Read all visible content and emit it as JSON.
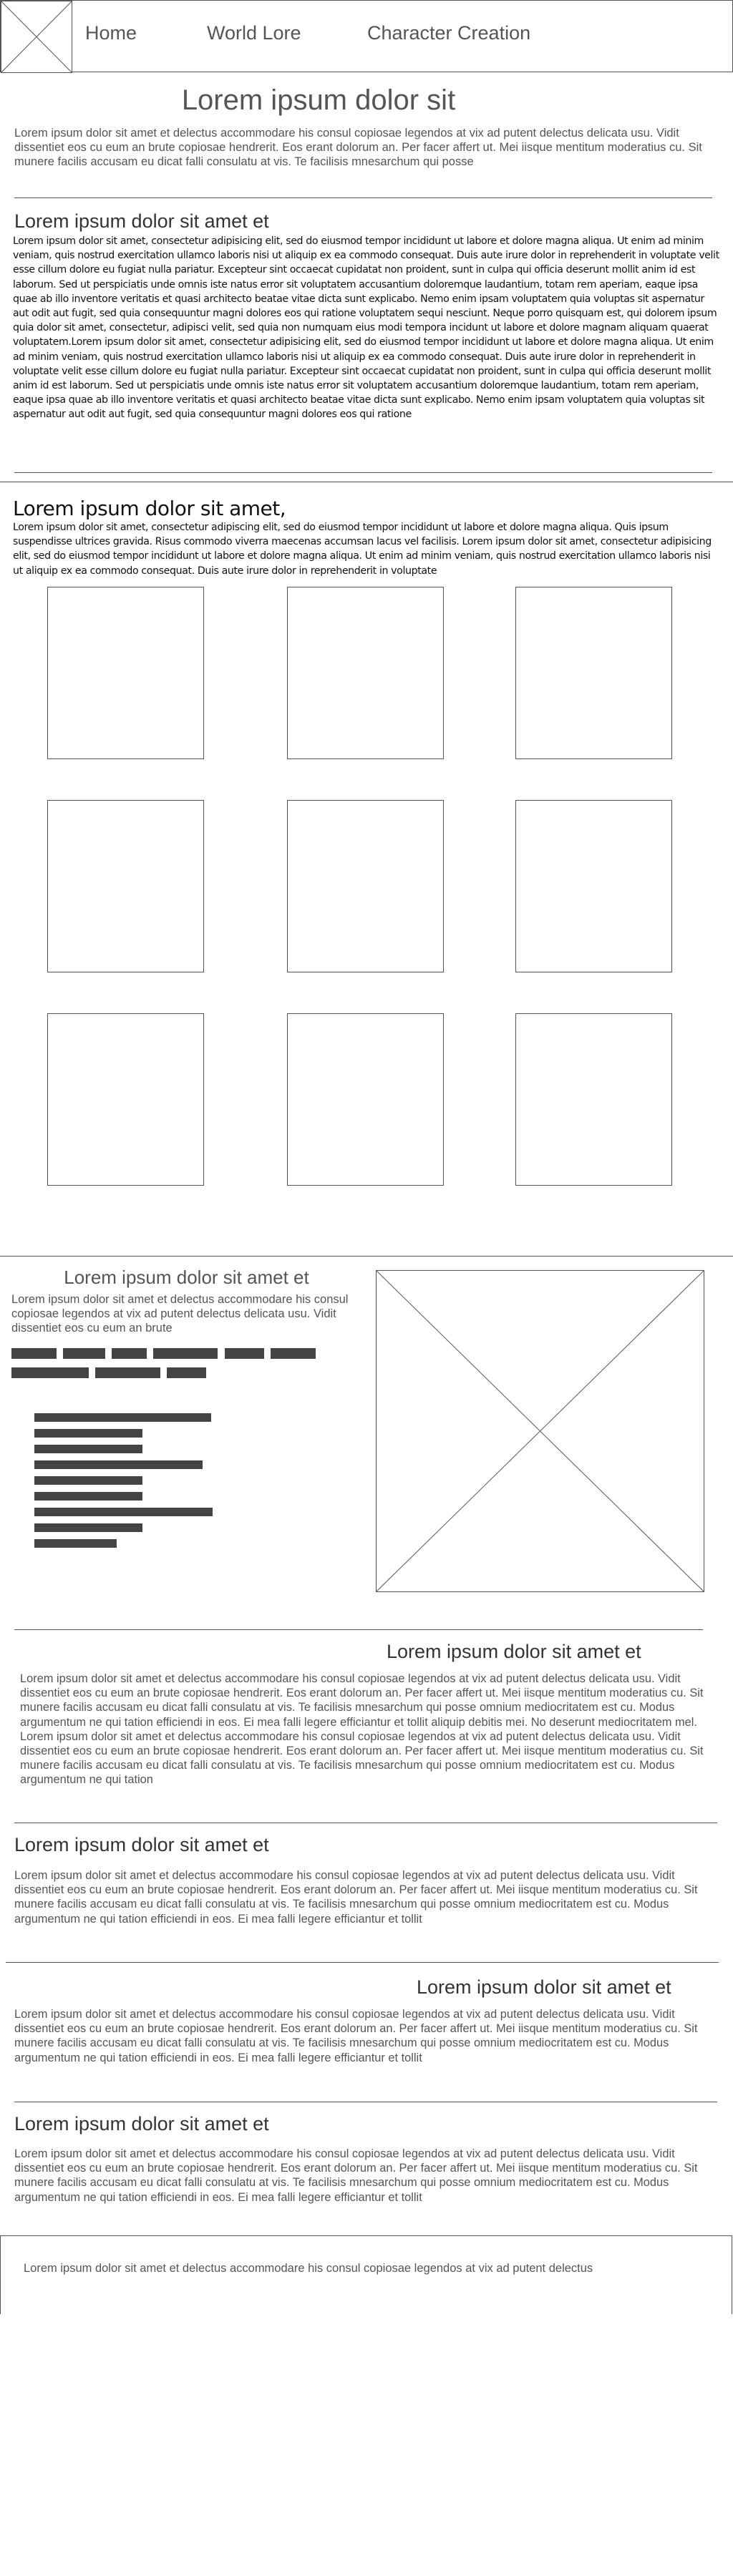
{
  "header": {
    "nav": [
      "Home",
      "World Lore",
      "Character Creation"
    ]
  },
  "hero": {
    "title": "Lorem ipsum dolor sit",
    "text": "Lorem ipsum dolor sit amet et delectus accommodare his consul copiosae legendos at vix ad putent delectus delicata usu. Vidit dissentiet eos cu eum an brute copiosae hendrerit. Eos erant dolorum an. Per facer affert ut. Mei iisque mentitum moderatius cu. Sit munere facilis accusam eu dicat falli consulatu at vis. Te facilisis mnesarchum qui posse"
  },
  "section1": {
    "title": "Lorem ipsum dolor sit amet et",
    "text": "Lorem ipsum dolor sit amet, consectetur adipisicing elit, sed do eiusmod tempor incididunt ut labore et dolore magna aliqua. Ut enim ad minim veniam, quis nostrud exercitation ullamco laboris nisi ut aliquip ex ea commodo consequat. Duis aute irure dolor in reprehenderit in voluptate velit esse cillum dolore eu fugiat nulla pariatur. Excepteur sint occaecat cupidatat non proident, sunt in culpa qui officia deserunt mollit anim id est laborum. Sed ut perspiciatis unde omnis iste natus error sit voluptatem accusantium doloremque laudantium, totam rem aperiam, eaque ipsa quae ab illo inventore veritatis et quasi architecto beatae vitae dicta sunt explicabo. Nemo enim ipsam voluptatem quia voluptas sit aspernatur aut odit aut fugit, sed quia consequuntur magni dolores eos qui ratione voluptatem sequi nesciunt. Neque porro quisquam est, qui dolorem ipsum quia dolor sit amet, consectetur, adipisci velit, sed quia non numquam eius modi tempora incidunt ut labore et dolore magnam aliquam quaerat voluptatem.Lorem ipsum dolor sit amet, consectetur adipisicing elit, sed do eiusmod tempor incididunt ut labore et dolore magna aliqua. Ut enim ad minim veniam, quis nostrud exercitation ullamco laboris nisi ut aliquip ex ea commodo consequat. Duis aute irure dolor in reprehenderit in voluptate velit esse cillum dolore eu fugiat nulla pariatur. Excepteur sint occaecat cupidatat non proident, sunt in culpa qui officia deserunt mollit anim id est laborum. Sed ut perspiciatis unde omnis iste natus error sit voluptatem accusantium doloremque laudantium, totam rem aperiam, eaque ipsa quae ab illo inventore veritatis et quasi architecto beatae vitae dicta sunt explicabo. Nemo enim ipsam voluptatem quia voluptas sit aspernatur aut odit aut fugit, sed quia consequuntur magni dolores eos qui ratione"
  },
  "section2": {
    "title": "Lorem ipsum dolor sit amet,",
    "text": "Lorem ipsum dolor sit amet, consectetur adipiscing elit, sed do eiusmod tempor incididunt ut labore et dolore magna aliqua. Quis ipsum suspendisse ultrices gravida. Risus commodo viverra maecenas accumsan lacus vel facilisis. Lorem ipsum dolor sit amet, consectetur adipisicing elit, sed do eiusmod tempor incididunt ut labore et dolore magna aliqua. Ut enim ad minim veniam, quis nostrud exercitation ullamco laboris nisi ut aliquip ex ea commodo consequat. Duis aute irure dolor in reprehenderit in voluptate"
  },
  "feature": {
    "title": "Lorem ipsum dolor sit amet et",
    "text": "Lorem ipsum dolor sit amet et delectus accommodare his consul copiosae legendos at vix ad putent delectus delicata usu. Vidit dissentiet eos cu eum an brute"
  },
  "blocks": [
    {
      "title": "Lorem ipsum dolor sit amet et",
      "text": "Lorem ipsum dolor sit amet et delectus accommodare his consul copiosae legendos at vix ad putent delectus delicata usu. Vidit dissentiet eos cu eum an brute copiosae hendrerit. Eos erant dolorum an. Per facer affert ut. Mei iisque mentitum moderatius cu. Sit munere facilis accusam eu dicat falli consulatu at vis. Te facilisis mnesarchum qui posse omnium mediocritatem est cu. Modus argumentum ne qui tation efficiendi in eos. Ei mea falli legere efficiantur et tollit aliquip debitis mei. No deserunt mediocritatem mel. Lorem ipsum dolor sit amet et delectus accommodare his consul copiosae legendos at vix ad putent delectus delicata usu. Vidit dissentiet eos cu eum an brute copiosae hendrerit. Eos erant dolorum an. Per facer affert ut. Mei iisque mentitum moderatius cu. Sit munere facilis accusam eu dicat falli consulatu at vis. Te facilisis mnesarchum qui posse omnium mediocritatem est cu. Modus argumentum ne qui tation"
    },
    {
      "title": "Lorem ipsum dolor sit amet et",
      "text": "Lorem ipsum dolor sit amet et delectus accommodare his consul copiosae legendos at vix ad putent delectus delicata usu. Vidit dissentiet eos cu eum an brute copiosae hendrerit. Eos erant dolorum an. Per facer affert ut. Mei iisque mentitum moderatius cu. Sit munere facilis accusam eu dicat falli consulatu at vis. Te facilisis mnesarchum qui posse omnium mediocritatem est cu. Modus argumentum ne qui tation efficiendi in eos. Ei mea falli legere efficiantur et tollit"
    },
    {
      "title": "Lorem ipsum dolor sit amet et",
      "text": "Lorem ipsum dolor sit amet et delectus accommodare his consul copiosae legendos at vix ad putent delectus delicata usu. Vidit dissentiet eos cu eum an brute copiosae hendrerit. Eos erant dolorum an. Per facer affert ut. Mei iisque mentitum moderatius cu. Sit munere facilis accusam eu dicat falli consulatu at vis. Te facilisis mnesarchum qui posse omnium mediocritatem est cu. Modus argumentum ne qui tation efficiendi in eos. Ei mea falli legere efficiantur et tollit"
    },
    {
      "title": "Lorem ipsum dolor sit amet et",
      "text": "Lorem ipsum dolor sit amet et delectus accommodare his consul copiosae legendos at vix ad putent delectus delicata usu. Vidit dissentiet eos cu eum an brute copiosae hendrerit. Eos erant dolorum an. Per facer affert ut. Mei iisque mentitum moderatius cu. Sit munere facilis accusam eu dicat falli consulatu at vis. Te facilisis mnesarchum qui posse omnium mediocritatem est cu. Modus argumentum ne qui tation efficiendi in eos. Ei mea falli legere efficiantur et tollit"
    }
  ],
  "footer": {
    "text": "Lorem ipsum dolor sit amet et delectus accommodare his consul copiosae legendos at vix ad putent delectus"
  }
}
